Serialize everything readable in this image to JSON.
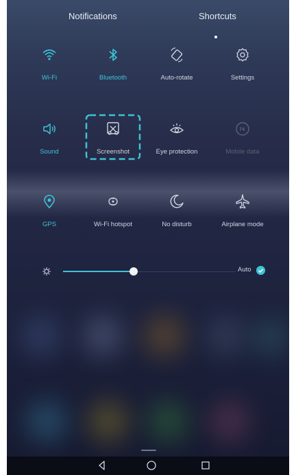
{
  "tabs": {
    "notifications": "Notifications",
    "shortcuts": "Shortcuts"
  },
  "tiles": [
    {
      "label": "Wi-Fi",
      "state": "on",
      "icon": "wifi-icon"
    },
    {
      "label": "Bluetooth",
      "state": "on",
      "icon": "bluetooth-icon"
    },
    {
      "label": "Auto-rotate",
      "state": "off",
      "icon": "auto-rotate-icon"
    },
    {
      "label": "Settings",
      "state": "neutral",
      "icon": "gear-icon"
    },
    {
      "label": "Sound",
      "state": "on",
      "icon": "speaker-icon"
    },
    {
      "label": "Screenshot",
      "state": "neutral",
      "icon": "screenshot-icon"
    },
    {
      "label": "Eye protection",
      "state": "neutral",
      "icon": "eye-icon"
    },
    {
      "label": "Mobile data",
      "state": "disabled",
      "icon": "mobile-data-icon"
    },
    {
      "label": "GPS",
      "state": "on",
      "icon": "location-icon"
    },
    {
      "label": "Wi-Fi hotspot",
      "state": "neutral",
      "icon": "hotspot-icon"
    },
    {
      "label": "No disturb",
      "state": "neutral",
      "icon": "moon-icon"
    },
    {
      "label": "Airplane mode",
      "state": "neutral",
      "icon": "airplane-icon"
    }
  ],
  "brightness": {
    "level": 0.41,
    "auto_label": "Auto",
    "auto_checked": true
  },
  "colors": {
    "accent": "#3ec3d6",
    "text": "#cfd5e2",
    "disabled": "#5a6176"
  },
  "navbar": {
    "back": "back-icon",
    "home": "home-icon",
    "recents": "recents-icon"
  }
}
